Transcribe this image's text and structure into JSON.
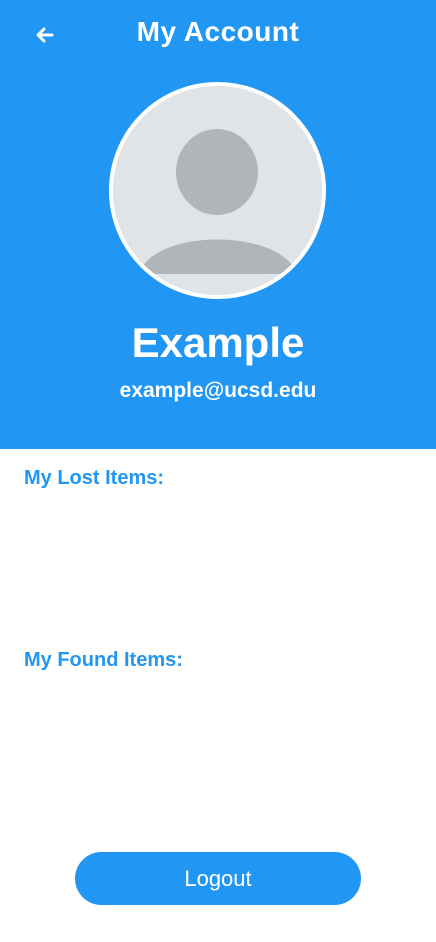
{
  "header": {
    "title": "My Account",
    "back_icon": "arrow-left-icon",
    "background_color": "#2196f3"
  },
  "profile": {
    "avatar_icon": "user-avatar-placeholder-icon",
    "name": "Example",
    "email": "example@ucsd.edu"
  },
  "sections": {
    "lost_items": {
      "heading": "My Lost Items:",
      "items": []
    },
    "found_items": {
      "heading": "My Found Items:",
      "items": []
    }
  },
  "actions": {
    "logout_label": "Logout"
  }
}
